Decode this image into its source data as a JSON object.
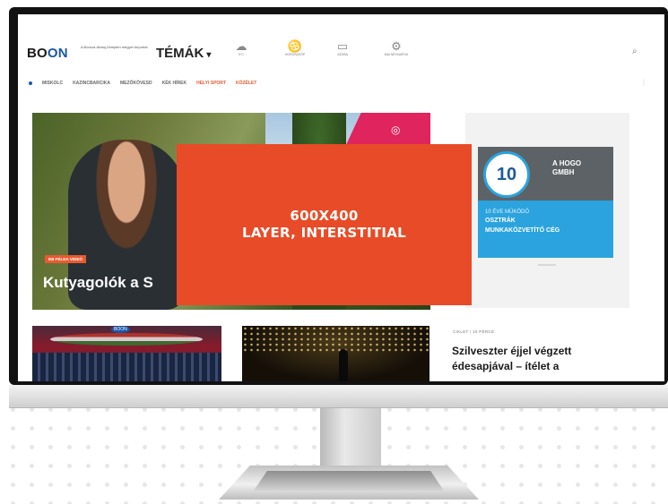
{
  "site": {
    "logo_part1": "BO",
    "logo_part2": "ON",
    "tagline": "A Borsod-Abaúj-Zemplén megyei hírportál",
    "topics_label": "TÉMÁK",
    "topics_caret": "▾"
  },
  "header_icons": [
    {
      "name": "weather",
      "glyph": "☁",
      "label": "9°C"
    },
    {
      "name": "horoscope",
      "glyph": "♋",
      "label": "HOROSZKÓP"
    },
    {
      "name": "tv",
      "glyph": "▭",
      "label": "SZOBA"
    },
    {
      "name": "namesday",
      "glyph": "⚙",
      "label": "MAI NÉVNAPOK"
    }
  ],
  "search_icon": "⌕",
  "nav": {
    "items": [
      "MISKOLC",
      "KAZINCBARCIKA",
      "MEZŐKÖVESD",
      "KÉK HÍREK",
      "HELYI SPORT",
      "KÖZÉLET"
    ],
    "accent_indices": [
      4,
      5
    ],
    "kebab": "⋮"
  },
  "hero": {
    "badge": "IMI PÉLDA VIDEÓ",
    "title": "Kutyagolók a S",
    "ribbon_icon": "◎"
  },
  "ad": {
    "circle_text": "10",
    "brand_line1": "A HOGO",
    "brand_line2": "GMBH",
    "line1": "10 ÉVE MŰKÖDŐ",
    "line2": "OSZTRÁK",
    "line3": "MUNKAKÖZVETÍTŐ CÉG"
  },
  "bottom": {
    "thumb1_tag": "BOON",
    "article_meta": "CIKLET / 10 PERCE",
    "article_title": "Szilveszter éjjel végzett édesapjával – ítélet a"
  },
  "interstitial": {
    "line1": "600X400",
    "line2": "LAYER, INTERSTITIAL"
  },
  "colors": {
    "interstitial": "#e84b27",
    "brand_blue": "#1b56a6",
    "ad_blue": "#2aa3de",
    "accent_orange": "#e85a30"
  }
}
